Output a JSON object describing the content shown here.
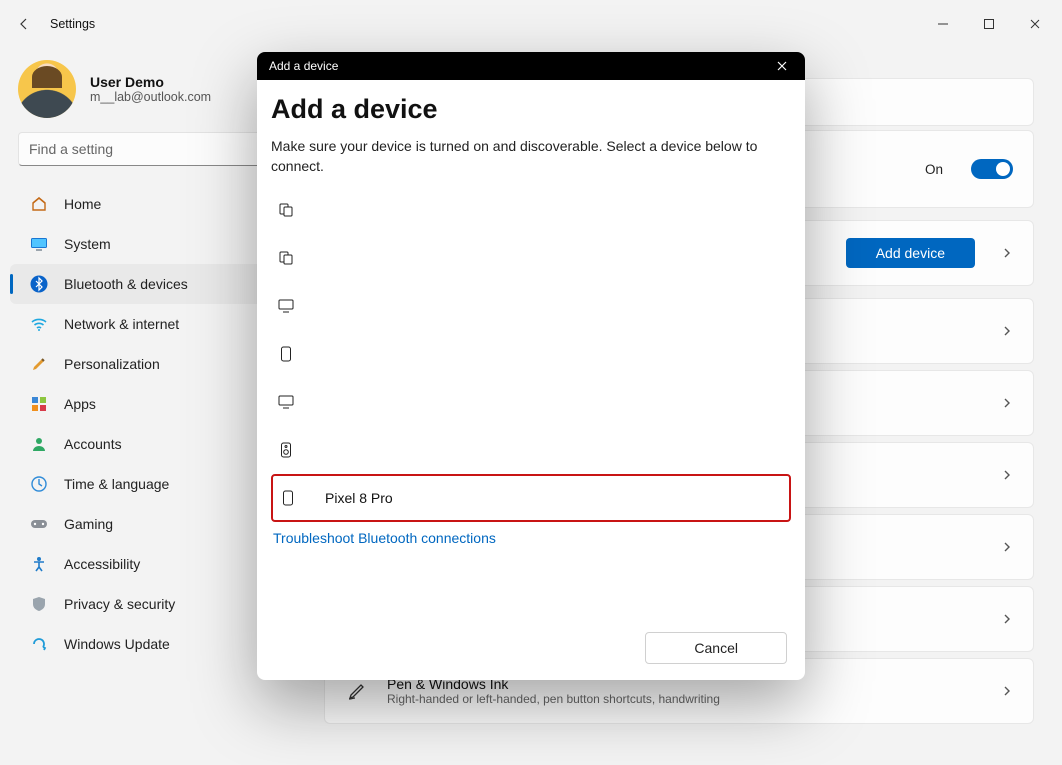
{
  "titlebar": {
    "appTitle": "Settings"
  },
  "user": {
    "name": "User Demo",
    "email": "m__lab@outlook.com"
  },
  "search": {
    "placeholder": "Find a setting"
  },
  "sidebar": {
    "items": [
      {
        "label": "Home"
      },
      {
        "label": "System"
      },
      {
        "label": "Bluetooth & devices"
      },
      {
        "label": "Network & internet"
      },
      {
        "label": "Personalization"
      },
      {
        "label": "Apps"
      },
      {
        "label": "Accounts"
      },
      {
        "label": "Time & language"
      },
      {
        "label": "Gaming"
      },
      {
        "label": "Accessibility"
      },
      {
        "label": "Privacy & security"
      },
      {
        "label": "Windows Update"
      }
    ]
  },
  "bluetooth": {
    "toggleState": "On",
    "addDeviceButton": "Add device"
  },
  "penCard": {
    "title": "Pen & Windows Ink",
    "sub": "Right-handed or left-handed, pen button shortcuts, handwriting"
  },
  "modal": {
    "titlebar": "Add a device",
    "heading": "Add a device",
    "description": "Make sure your device is turned on and discoverable. Select a device below to connect.",
    "devices": [
      {
        "label": ""
      },
      {
        "label": ""
      },
      {
        "label": ""
      },
      {
        "label": ""
      },
      {
        "label": ""
      },
      {
        "label": ""
      },
      {
        "label": "Pixel 8 Pro"
      }
    ],
    "troubleshoot": "Troubleshoot Bluetooth connections",
    "cancel": "Cancel"
  }
}
